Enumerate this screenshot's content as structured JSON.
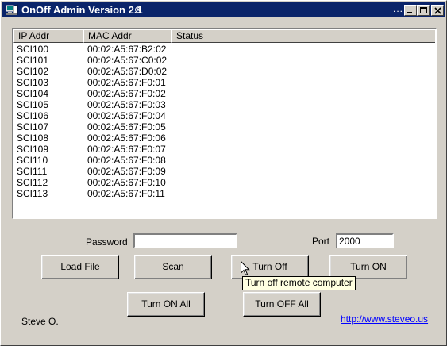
{
  "window": {
    "title": "OnOff Admin Version 2.1",
    "title_mark": "⊗",
    "title_dots": "...",
    "minimize_icon": "minimize-icon",
    "maximize_icon": "maximize-icon",
    "close_icon": "close-icon"
  },
  "list": {
    "columns": [
      "IP Addr",
      "MAC Addr",
      "Status"
    ],
    "rows": [
      {
        "ip": "SCI100",
        "mac": "00:02:A5:67:B2:02",
        "status": ""
      },
      {
        "ip": "SCI101",
        "mac": "00:02:A5:67:C0:02",
        "status": ""
      },
      {
        "ip": "SCI102",
        "mac": "00:02:A5:67:D0:02",
        "status": ""
      },
      {
        "ip": "SCI103",
        "mac": "00:02:A5:67:F0:01",
        "status": ""
      },
      {
        "ip": "SCI104",
        "mac": "00:02:A5:67:F0:02",
        "status": ""
      },
      {
        "ip": "SCI105",
        "mac": "00:02:A5:67:F0:03",
        "status": ""
      },
      {
        "ip": "SCI106",
        "mac": "00:02:A5:67:F0:04",
        "status": ""
      },
      {
        "ip": "SCI107",
        "mac": "00:02:A5:67:F0:05",
        "status": ""
      },
      {
        "ip": "SCI108",
        "mac": "00:02:A5:67:F0:06",
        "status": ""
      },
      {
        "ip": "SCI109",
        "mac": "00:02:A5:67:F0:07",
        "status": ""
      },
      {
        "ip": "SCI110",
        "mac": "00:02:A5:67:F0:08",
        "status": ""
      },
      {
        "ip": "SCI111",
        "mac": "00:02:A5:67:F0:09",
        "status": ""
      },
      {
        "ip": "SCI112",
        "mac": "00:02:A5:67:F0:10",
        "status": ""
      },
      {
        "ip": "SCI113",
        "mac": "00:02:A5:67:F0:11",
        "status": ""
      }
    ]
  },
  "form": {
    "password_label": "Password",
    "password_value": "",
    "port_label": "Port",
    "port_value": "2000"
  },
  "buttons": {
    "load_file": "Load File",
    "scan": "Scan",
    "turn_off": "Turn Off",
    "turn_on": "Turn ON",
    "turn_on_all": "Turn ON All",
    "turn_off_all": "Turn OFF All"
  },
  "tooltip": "Turn off remote computer",
  "footer": {
    "author": "Steve O.",
    "link": "http://www.steveo.us"
  },
  "colors": {
    "titlebar": "#0a246a",
    "face": "#d4d0c8",
    "tooltip": "#ffffe1",
    "link": "#0000ff"
  }
}
